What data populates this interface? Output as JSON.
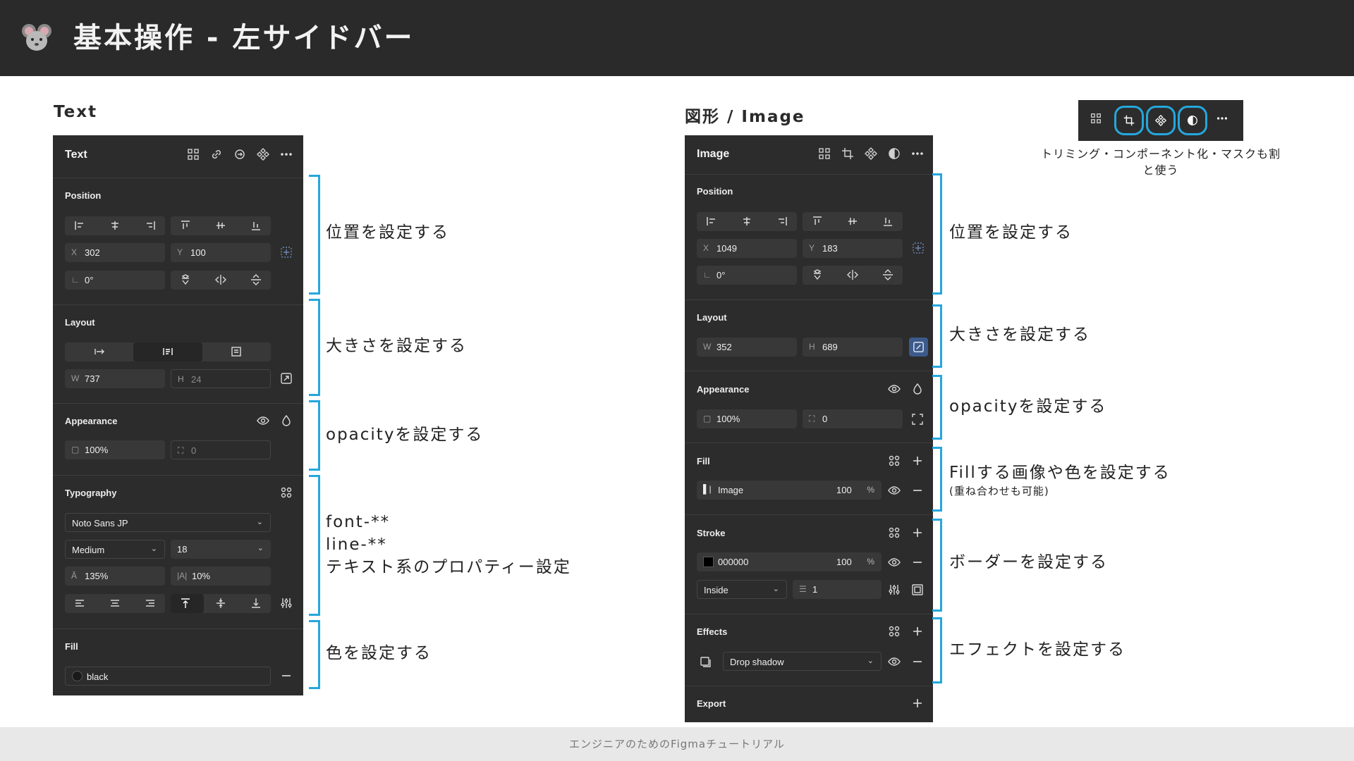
{
  "header": {
    "title": "基本操作 - 左サイドバー",
    "logo_icon": "mouse-icon"
  },
  "left": {
    "section_title": "Text",
    "panel": {
      "title": "Text",
      "position_label": "Position",
      "x_label": "X",
      "x": "302",
      "y_label": "Y",
      "y": "100",
      "rotation": "0°",
      "layout_label": "Layout",
      "w_label": "W",
      "w": "737",
      "h_label": "H",
      "h": "24",
      "appearance_label": "Appearance",
      "opacity": "100%",
      "radius": "0",
      "typography_label": "Typography",
      "font_family": "Noto Sans JP",
      "font_weight": "Medium",
      "font_size": "18",
      "line_height": "135%",
      "letter_spacing": "10%",
      "fill_label": "Fill",
      "fill_value": "black"
    },
    "notes": {
      "position": "位置を設定する",
      "size": "大きさを設定する",
      "opacity": "opacityを設定する",
      "font1": "font-**",
      "font2": "line-**",
      "font3": "テキスト系のプロパティー設定",
      "color": "色を設定する"
    }
  },
  "right": {
    "section_title": "図形 / Image",
    "panel": {
      "title": "Image",
      "position_label": "Position",
      "x_label": "X",
      "x": "1049",
      "y_label": "Y",
      "y": "183",
      "rotation": "0°",
      "layout_label": "Layout",
      "w_label": "W",
      "w": "352",
      "h_label": "H",
      "h": "689",
      "appearance_label": "Appearance",
      "opacity": "100%",
      "radius": "0",
      "fill_label": "Fill",
      "fill_value": "Image",
      "fill_opacity": "100",
      "fill_pct": "%",
      "stroke_label": "Stroke",
      "stroke_color": "000000",
      "stroke_opacity": "100",
      "stroke_pct": "%",
      "stroke_position": "Inside",
      "stroke_weight": "1",
      "effects_label": "Effects",
      "effect_value": "Drop shadow",
      "export_label": "Export"
    },
    "notes": {
      "position": "位置を設定する",
      "size": "大きさを設定する",
      "opacity": "opacityを設定する",
      "fill": "Fillする画像や色を設定する",
      "fill_sub": "(重ね合わせも可能)",
      "stroke": "ボーダーを設定する",
      "effects": "エフェクトを設定する"
    },
    "toolbar_caption": "トリミング・コンポーネント化・マスクも割と使う"
  },
  "footer": {
    "text": "エンジニアのためのFigmaチュートリアル"
  },
  "colors": {
    "accent": "#25a7dc",
    "panel_bg": "#2c2c2c",
    "header_bg": "#2a2a2a",
    "selected_blue": "#3c5a8a"
  }
}
